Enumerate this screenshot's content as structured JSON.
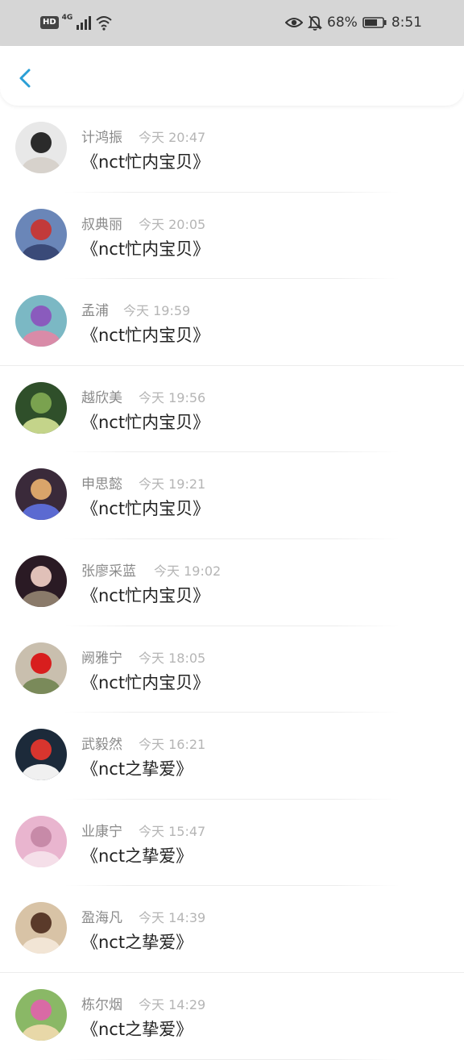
{
  "status_bar": {
    "hd": "HD",
    "network": "4G",
    "battery_percent": "68%",
    "time": "8:51",
    "icons": [
      "signal-icon",
      "wifi-icon",
      "eye-icon",
      "bell-off-icon",
      "battery-icon"
    ]
  },
  "nav": {
    "back_icon": "chevron-left-icon",
    "accent": "#2a9fd6"
  },
  "items": [
    {
      "name": "计鸿振",
      "time": "今天 20:47",
      "title": "《nct忙内宝贝》"
    },
    {
      "name": "叔典丽",
      "time": "今天 20:05",
      "title": "《nct忙内宝贝》"
    },
    {
      "name": "孟浦",
      "time": "今天 19:59",
      "title": "《nct忙内宝贝》"
    },
    {
      "name": "越欣美",
      "time": "今天 19:56",
      "title": "《nct忙内宝贝》"
    },
    {
      "name": "申思懿",
      "time": "今天 19:21",
      "title": "《nct忙内宝贝》"
    },
    {
      "name": "张廖采蓝",
      "time": "今天 19:02",
      "title": "《nct忙内宝贝》"
    },
    {
      "name": "阙雅宁",
      "time": "今天 18:05",
      "title": "《nct忙内宝贝》"
    },
    {
      "name": "武毅然",
      "time": "今天 16:21",
      "title": "《nct之挚爱》"
    },
    {
      "name": "业康宁",
      "time": "今天 15:47",
      "title": "《nct之挚爱》"
    },
    {
      "name": "盈海凡",
      "time": "今天 14:39",
      "title": "《nct之挚爱》"
    },
    {
      "name": "栋尔烟",
      "time": "今天 14:29",
      "title": "《nct之挚爱》"
    }
  ]
}
